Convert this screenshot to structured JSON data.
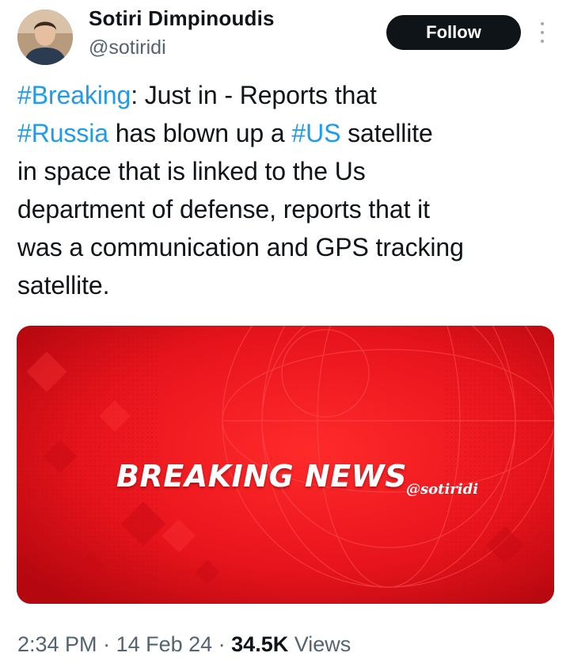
{
  "author": {
    "display_name": "Sotiri Dimpinoudis",
    "handle": "@sotiridi"
  },
  "header": {
    "follow_label": "Follow"
  },
  "tweet": {
    "lines": [
      [
        {
          "text": "#Breaking",
          "type": "hashtag"
        },
        {
          "text": ": Just in - Reports that",
          "type": "text"
        }
      ],
      [
        {
          "text": "#Russia",
          "type": "hashtag"
        },
        {
          "text": " has blown up a ",
          "type": "text"
        },
        {
          "text": "#US",
          "type": "hashtag"
        },
        {
          "text": " satellite",
          "type": "text"
        }
      ],
      [
        {
          "text": "in space that is linked to the Us",
          "type": "text"
        }
      ],
      [
        {
          "text": "department of defense, reports that it",
          "type": "text"
        }
      ],
      [
        {
          "text": "was a communication and GPS tracking",
          "type": "text"
        }
      ],
      [
        {
          "text": "satellite.",
          "type": "text"
        }
      ]
    ]
  },
  "media": {
    "headline": "BREAKING NEWS",
    "watermark": "@sotiridi",
    "background_color": "#e8141c"
  },
  "meta": {
    "time": "2:34 PM",
    "separator": " · ",
    "date": "14 Feb 24",
    "views_count": "34.5K",
    "views_label": " Views"
  },
  "colors": {
    "hashtag": "#1d9bf0",
    "text": "#0f1419",
    "muted": "#536471",
    "button": "#0f1419"
  },
  "icons": {
    "more": "more-vertical-icon"
  }
}
